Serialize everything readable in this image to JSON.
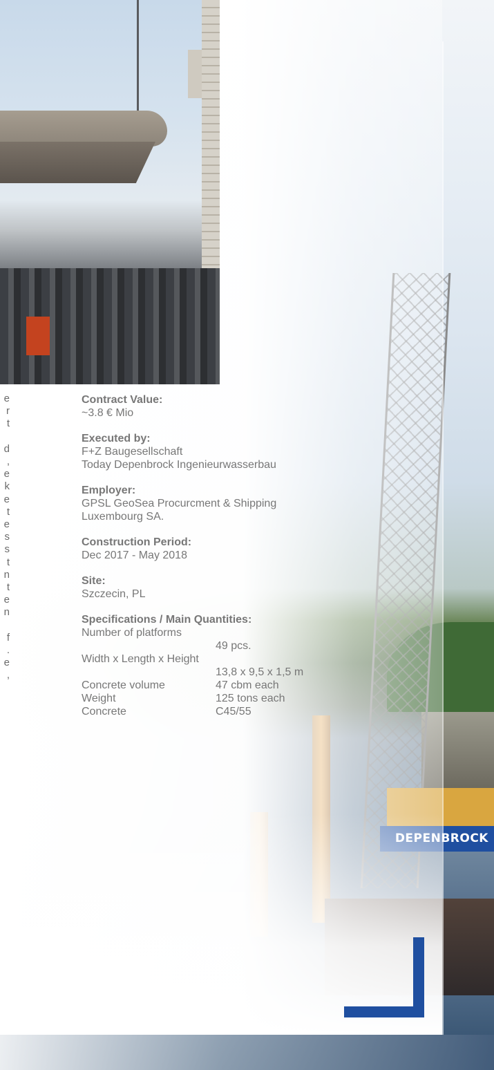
{
  "brand_sign": "DEPENBROCK",
  "left_column_fragments": [
    "e",
    "r",
    "t",
    "",
    "d",
    ",",
    "e",
    "k",
    "e",
    "t",
    "e",
    "s",
    "s",
    "t",
    "n",
    "t",
    "e",
    "n",
    "",
    "f",
    ".",
    "e",
    ","
  ],
  "contract_value": {
    "label": "Contract Value:",
    "value": "~3.8  € Mio"
  },
  "executed_by": {
    "label": "Executed by:",
    "lines": [
      "F+Z Baugesellschaft",
      "Today Depenbrock Ingenieurwasserbau"
    ]
  },
  "employer": {
    "label": "Employer:",
    "lines": [
      "GPSL GeoSea Procurcment & Shipping",
      "Luxembourg SA."
    ]
  },
  "construction_period": {
    "label": "Construction Period:",
    "value": "Dec 2017  - May 2018"
  },
  "site": {
    "label": "Site:",
    "value": "Szczecin, PL"
  },
  "specifications": {
    "label": "Specifications / Main Quantities:",
    "number_of_platforms": {
      "label": "Number of platforms",
      "value": "49 pcs."
    },
    "dimensions": {
      "label": "Width x Length x Height",
      "value": "13,8 x 9,5 x 1,5 m"
    },
    "concrete_volume": {
      "label": "Concrete volume",
      "value": "47 cbm each"
    },
    "weight": {
      "label": "Weight",
      "value": "125 tons each"
    },
    "concrete": {
      "label": "Concrete",
      "value": "C45/55"
    }
  },
  "colors": {
    "brand_blue": "#1f4fa0",
    "text_gray": "#777777"
  }
}
